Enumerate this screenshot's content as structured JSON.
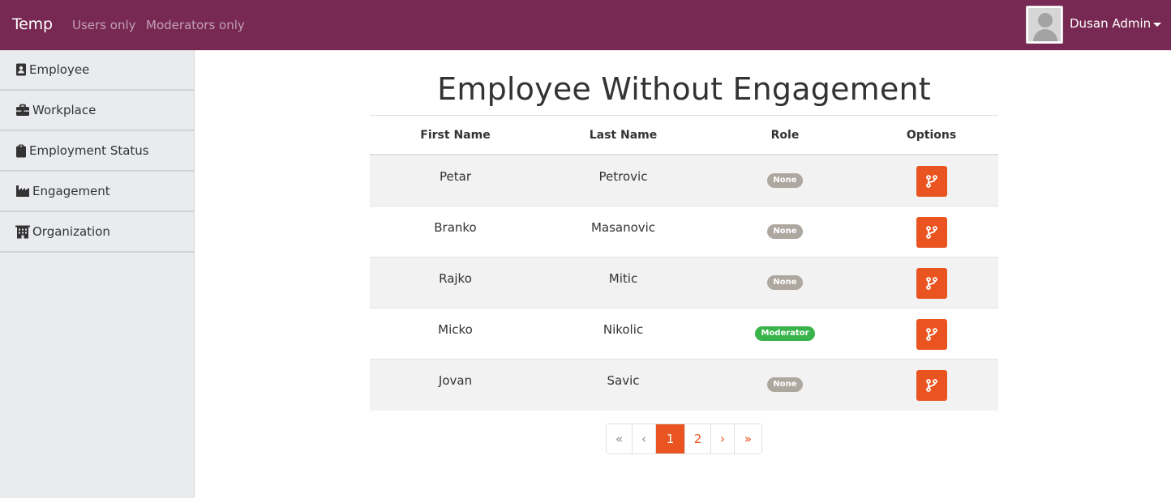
{
  "navbar": {
    "brand": "Temp",
    "links": [
      "Users only",
      "Moderators only"
    ],
    "user_name": "Dusan Admin",
    "avatar_icon": "user-avatar-placeholder"
  },
  "sidebar": {
    "items": [
      {
        "label": "Employee",
        "icon": "address-card-icon"
      },
      {
        "label": "Workplace",
        "icon": "briefcase-icon"
      },
      {
        "label": "Employment Status",
        "icon": "clipboard-icon"
      },
      {
        "label": "Engagement",
        "icon": "industry-icon"
      },
      {
        "label": "Organization",
        "icon": "building-icon"
      }
    ]
  },
  "main": {
    "title": "Employee Without Engagement",
    "table": {
      "columns": [
        "First Name",
        "Last Name",
        "Role",
        "Options"
      ],
      "rows": [
        {
          "first": "Petar",
          "last": "Petrovic",
          "role": "None"
        },
        {
          "first": "Branko",
          "last": "Masanovic",
          "role": "None"
        },
        {
          "first": "Rajko",
          "last": "Mitic",
          "role": "None"
        },
        {
          "first": "Micko",
          "last": "Nikolic",
          "role": "Moderator"
        },
        {
          "first": "Jovan",
          "last": "Savic",
          "role": "None"
        }
      ],
      "option_icon": "code-branch-icon"
    },
    "pagination": {
      "items": [
        "«",
        "‹",
        "1",
        "2",
        "›",
        "»"
      ],
      "active_page": "1"
    }
  },
  "colors": {
    "navbar": "#772953",
    "accent": "#e95420",
    "badge_none": "#aea79f",
    "badge_moderator": "#38b44a",
    "sidebar_bg": "#e9ebee"
  }
}
